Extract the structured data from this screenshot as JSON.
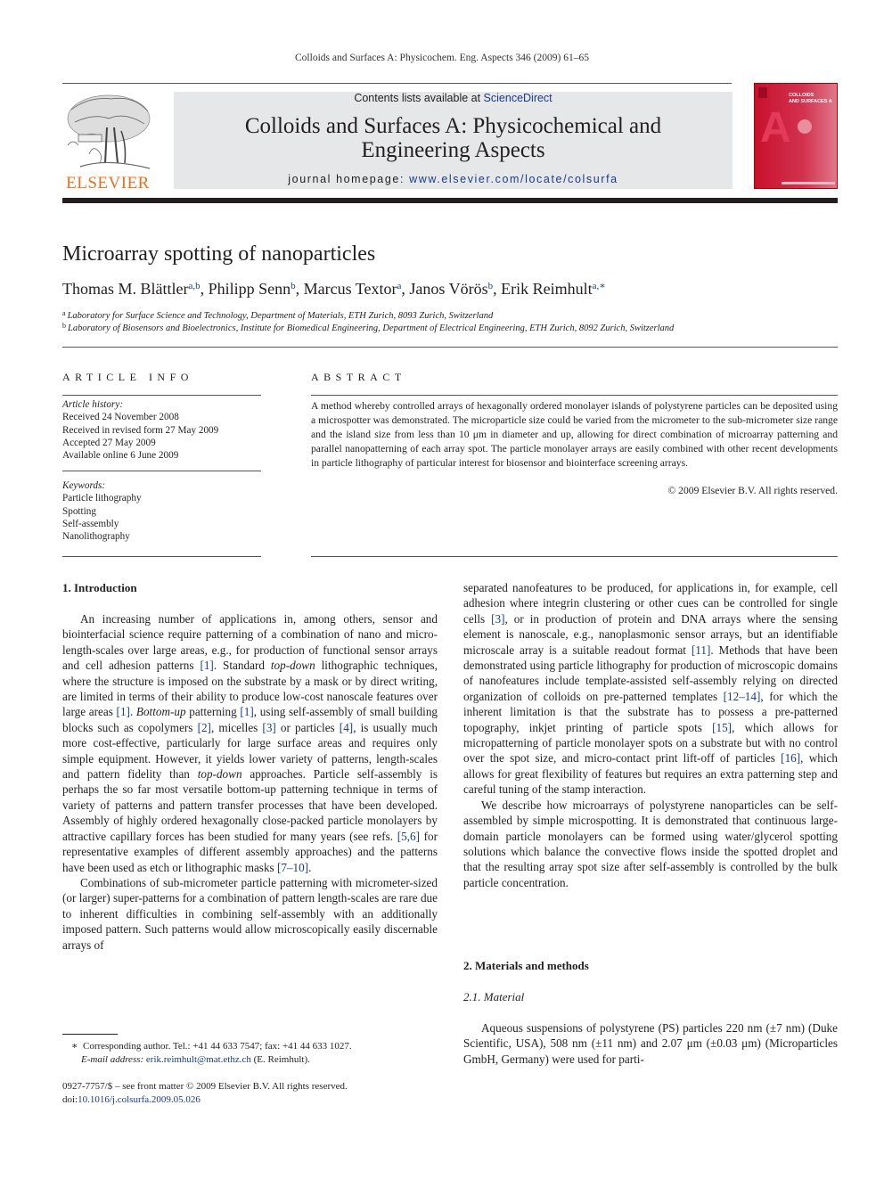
{
  "running_head": "Colloids and Surfaces A: Physicochem. Eng. Aspects 346 (2009) 61–65",
  "masthead": {
    "publisher_logo_text": "ELSEVIER",
    "contents_prefix": "Contents lists available at ",
    "contents_link": "ScienceDirect",
    "journal_title_line1": "Colloids and Surfaces A: Physicochemical and",
    "journal_title_line2": "Engineering Aspects",
    "homepage_prefix": "journal homepage: ",
    "homepage_url": "www.elsevier.com/locate/colsurfa",
    "cover": {
      "title_line1": "COLLOIDS",
      "title_line2": "AND SURFACES A",
      "letter": "A",
      "accent_color": "#c8102e"
    }
  },
  "article": {
    "title": "Microarray spotting of nanoparticles",
    "authors": [
      {
        "name": "Thomas M. Blättler",
        "sup": "a,b",
        "sep": ", "
      },
      {
        "name": "Philipp Senn",
        "sup": "b",
        "sep": ", "
      },
      {
        "name": "Marcus Textor",
        "sup": "a",
        "sep": ", "
      },
      {
        "name": "Janos Vörös",
        "sup": "b",
        "sep": ", "
      },
      {
        "name": "Erik Reimhult",
        "sup": "a,∗",
        "sep": ""
      }
    ],
    "affiliations": [
      {
        "mark": "a",
        "text": "Laboratory for Surface Science and Technology, Department of Materials, ETH Zurich, 8093 Zurich, Switzerland"
      },
      {
        "mark": "b",
        "text": "Laboratory of Biosensors and Bioelectronics, Institute for Biomedical Engineering, Department of Electrical Engineering, ETH Zurich, 8092 Zurich, Switzerland"
      }
    ]
  },
  "article_info": {
    "heading": "ARTICLE INFO",
    "history_label": "Article history:",
    "history": [
      "Received 24 November 2008",
      "Received in revised form 27 May 2009",
      "Accepted 27 May 2009",
      "Available online 6 June 2009"
    ],
    "keywords_label": "Keywords:",
    "keywords": [
      "Particle lithography",
      "Spotting",
      "Self-assembly",
      "Nanolithography"
    ]
  },
  "abstract": {
    "heading": "ABSTRACT",
    "text": "A method whereby controlled arrays of hexagonally ordered monolayer islands of polystyrene particles can be deposited using a microspotter was demonstrated. The microparticle size could be varied from the micrometer to the sub-micrometer size range and the island size from less than 10 μm in diameter and up, allowing for direct combination of microarray patterning and parallel nanopatterning of each array spot. The particle monolayer arrays are easily combined with other recent developments in particle lithography of particular interest for biosensor and biointerface screening arrays.",
    "copyright": "© 2009 Elsevier B.V. All rights reserved."
  },
  "body": {
    "section1_heading": "1.  Introduction",
    "left_paragraphs": [
      [
        {
          "t": "An increasing number of applications in, among others, sensor and biointerfacial science require patterning of a combination of nano and micro-length-scales over large areas, e.g., for production of functional sensor arrays and cell adhesion patterns "
        },
        {
          "r": "[1]"
        },
        {
          "t": ". Standard "
        },
        {
          "i": "top-down"
        },
        {
          "t": " lithographic techniques, where the structure is imposed on the substrate by a mask or by direct writing, are limited in terms of their ability to produce low-cost nanoscale features over large areas "
        },
        {
          "r": "[1]"
        },
        {
          "t": ". "
        },
        {
          "i": "Bottom-up"
        },
        {
          "t": " patterning "
        },
        {
          "r": "[1]"
        },
        {
          "t": ", using self-assembly of small building blocks such as copolymers "
        },
        {
          "r": "[2]"
        },
        {
          "t": ", micelles "
        },
        {
          "r": "[3]"
        },
        {
          "t": " or particles "
        },
        {
          "r": "[4]"
        },
        {
          "t": ", is usually much more cost-effective, particularly for large surface areas and requires only simple equipment. However, it yields lower variety of patterns, length-scales and pattern fidelity than "
        },
        {
          "i": "top-down"
        },
        {
          "t": " approaches. Particle self-assembly is perhaps the so far most versatile bottom-up patterning technique in terms of variety of patterns and pattern transfer processes that have been developed. Assembly of highly ordered hexagonally close-packed particle monolayers by attractive capillary forces has been studied for many years (see refs. "
        },
        {
          "r": "[5,6]"
        },
        {
          "t": " for representative examples of different assembly approaches) and the patterns have been used as etch or lithographic masks "
        },
        {
          "r": "[7–10]"
        },
        {
          "t": "."
        }
      ],
      [
        {
          "t": "Combinations of sub-micrometer particle patterning with micrometer-sized (or larger) super-patterns for a combination of pattern length-scales are rare due to inherent difficulties in combining self-assembly with an additionally imposed pattern. Such patterns would allow microscopically easily discernable arrays of"
        }
      ]
    ],
    "right_paragraphs": [
      [
        {
          "t": "separated nanofeatures to be produced, for applications in, for example, cell adhesion where integrin clustering or other cues can be controlled for single cells "
        },
        {
          "r": "[3]"
        },
        {
          "t": ", or in production of protein and DNA arrays where the sensing element is nanoscale, e.g., nanoplasmonic sensor arrays, but an identifiable microscale array is a suitable readout format "
        },
        {
          "r": "[11]"
        },
        {
          "t": ". Methods that have been demonstrated using particle lithography for production of microscopic domains of nanofeatures include template-assisted self-assembly relying on directed organization of colloids on pre-patterned templates "
        },
        {
          "r": "[12–14]"
        },
        {
          "t": ", for which the inherent limitation is that the substrate has to possess a pre-patterned topography, inkjet printing of particle spots "
        },
        {
          "r": "[15]"
        },
        {
          "t": ", which allows for micropatterning of particle monolayer spots on a substrate but with no control over the spot size, and micro-contact print lift-off of particles "
        },
        {
          "r": "[16]"
        },
        {
          "t": ", which allows for great flexibility of features but requires an extra patterning step and careful tuning of the stamp interaction."
        }
      ],
      [
        {
          "t": "We describe how microarrays of polystyrene nanoparticles can be self-assembled by simple microspotting. It is demonstrated that continuous large-domain particle monolayers can be formed using water/glycerol spotting solutions which balance the convective flows inside the spotted droplet and that the resulting array spot size after self-assembly is controlled by the bulk particle concentration."
        }
      ]
    ],
    "section2_heading": "2.  Materials and methods",
    "subsection21_heading": "2.1.  Material",
    "material_paragraph": "Aqueous suspensions of polystyrene (PS) particles 220 nm (±7 nm) (Duke Scientific, USA), 508 nm (±11 nm) and 2.07 μm (±0.03 μm) (Microparticles GmbH, Germany) were used for parti-"
  },
  "footnote": {
    "mark": "∗",
    "corresponding": "Corresponding author. Tel.: +41 44 633 7547; fax: +41 44 633 1027.",
    "email_label": "E-mail address:",
    "email": "erik.reimhult@mat.ethz.ch",
    "email_suffix": " (E. Reimhult)."
  },
  "issn_line": "0927-7757/$ – see front matter © 2009 Elsevier B.V. All rights reserved.",
  "doi_prefix": "doi:",
  "doi": "10.1016/j.colsurfa.2009.05.026"
}
